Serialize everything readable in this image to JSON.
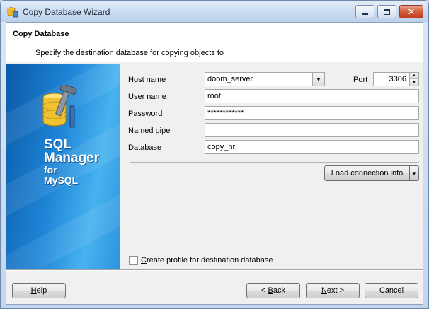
{
  "window": {
    "title": "Copy Database Wizard"
  },
  "header": {
    "title": "Copy Database",
    "subtitle": "Specify the destination database for copying objects to"
  },
  "brand": {
    "line1": "SQL",
    "line2": "Manager",
    "line3": "for",
    "line4": "MySQL"
  },
  "form": {
    "host_label_key": "H",
    "host_label_rest": "ost name",
    "host_value": "doom_server",
    "port_label_key": "P",
    "port_label_rest": "ort",
    "port_value": "3306",
    "user_label_key": "U",
    "user_label_rest": "ser name",
    "user_value": "root",
    "password_label_pre": "Pass",
    "password_label_key": "w",
    "password_label_rest": "ord",
    "password_value": "************",
    "pipe_label_key": "N",
    "pipe_label_rest": "amed pipe",
    "pipe_value": "",
    "database_label_key": "D",
    "database_label_rest": "atabase",
    "database_value": "copy_hr",
    "load_button": "Load connection info",
    "profile_label_key": "C",
    "profile_label_rest": "reate profile for destination database"
  },
  "footer": {
    "help_label_key": "H",
    "help_label_rest": "elp",
    "back_label_pre": "< ",
    "back_label_key": "B",
    "back_label_rest": "ack",
    "next_label_key": "N",
    "next_label_rest": "ext >",
    "cancel_label": "Cancel"
  }
}
